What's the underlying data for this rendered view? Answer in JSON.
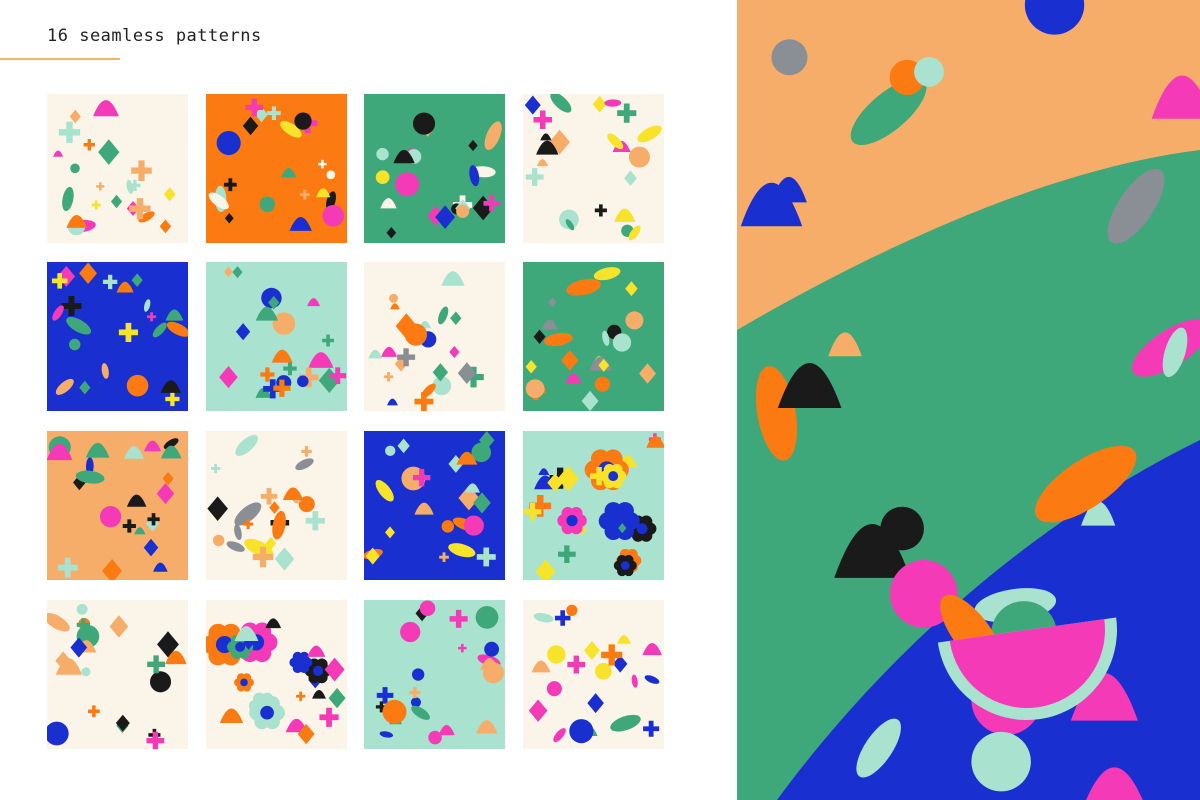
{
  "header": {
    "title": "16 seamless patterns"
  },
  "colors": {
    "cream": "#fbf4e8",
    "orange": "#fb7a12",
    "green": "#3ea87a",
    "blue": "#1a2fcf",
    "mint": "#a9e2cf",
    "peach": "#f7ad6a",
    "pink": "#f53ab8",
    "yellow": "#f7e42a",
    "black": "#1a1a1a",
    "grey": "#8a8f95"
  },
  "patterns": [
    {
      "name": "fruits-cream",
      "bg": "cream",
      "style": "fruit"
    },
    {
      "name": "abstract-orange",
      "bg": "orange",
      "style": "abstract"
    },
    {
      "name": "abstract-green",
      "bg": "green",
      "style": "abstract"
    },
    {
      "name": "abstract-cream",
      "bg": "cream",
      "style": "abstract"
    },
    {
      "name": "fruits-blue",
      "bg": "blue",
      "style": "fruit"
    },
    {
      "name": "leaves-mint",
      "bg": "mint",
      "style": "leaves"
    },
    {
      "name": "leaves-cream",
      "bg": "cream",
      "style": "leaves"
    },
    {
      "name": "citrus-green",
      "bg": "green",
      "style": "citrus"
    },
    {
      "name": "botanical-peach",
      "bg": "peach",
      "style": "botanical"
    },
    {
      "name": "lemons-cream",
      "bg": "cream",
      "style": "citrus"
    },
    {
      "name": "fruits-blue-2",
      "bg": "blue",
      "style": "orchard"
    },
    {
      "name": "flowers-mint",
      "bg": "mint",
      "style": "flowers"
    },
    {
      "name": "botanical-cream",
      "bg": "cream",
      "style": "botanical"
    },
    {
      "name": "flowers-cream",
      "bg": "cream",
      "style": "flowers"
    },
    {
      "name": "botanical-mint",
      "bg": "mint",
      "style": "botanical"
    },
    {
      "name": "orchard-cream",
      "bg": "cream",
      "style": "orchard"
    }
  ],
  "fabric": {
    "layers": [
      "peach",
      "green",
      "blue"
    ]
  }
}
